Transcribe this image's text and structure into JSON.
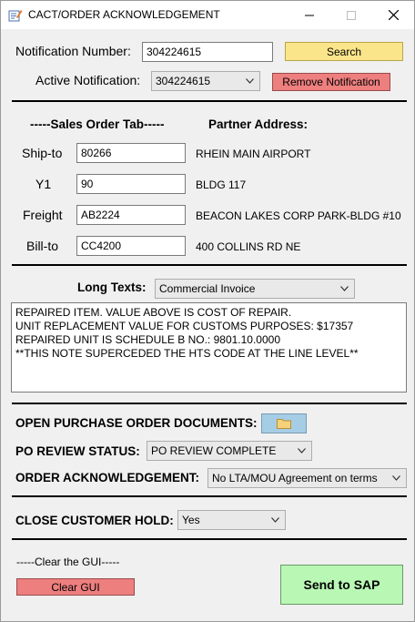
{
  "window": {
    "title": "CACT/ORDER ACKNOWLEDGEMENT"
  },
  "notification": {
    "number_label": "Notification Number:",
    "number_value": "304224615",
    "search_label": "Search",
    "active_label": "Active Notification:",
    "active_value": "304224615",
    "remove_label": "Remove Notification"
  },
  "sales_order": {
    "header": "-----Sales Order Tab-----",
    "partner_header": "Partner Address:",
    "rows": [
      {
        "label": "Ship-to",
        "value": "80266",
        "address": "RHEIN MAIN AIRPORT"
      },
      {
        "label": "Y1",
        "value": "90",
        "address": "BLDG 117"
      },
      {
        "label": "Freight",
        "value": "AB2224",
        "address": "BEACON LAKES CORP PARK-BLDG #10"
      },
      {
        "label": "Bill-to",
        "value": "CC4200",
        "address": "400 COLLINS RD NE"
      }
    ]
  },
  "long_texts": {
    "label": "Long Texts:",
    "selected": "Commercial Invoice",
    "lines": [
      "REPAIRED ITEM.  VALUE ABOVE IS COST OF REPAIR.",
      "UNIT REPLACEMENT VALUE FOR CUSTOMS PURPOSES: $17357",
      "REPAIRED UNIT IS SCHEDULE B NO.: 9801.10.0000",
      "**THIS NOTE SUPERCEDED THE HTS CODE AT THE LINE LEVEL**"
    ]
  },
  "po": {
    "open_docs_label": "OPEN PURCHASE ORDER DOCUMENTS:",
    "review_label": "PO REVIEW STATUS:",
    "review_value": "PO REVIEW COMPLETE",
    "ack_label": "ORDER ACKNOWLEDGEMENT:",
    "ack_value": "No LTA/MOU Agreement on terms"
  },
  "hold": {
    "label": "CLOSE CUSTOMER HOLD:",
    "value": "Yes"
  },
  "footer": {
    "clear_caption": "-----Clear the GUI-----",
    "clear_label": "Clear GUI",
    "send_label": "Send to SAP"
  },
  "colors": {
    "search_button": "#fbe58b",
    "remove_button": "#ee7f7f",
    "folder_button": "#a6cde6",
    "send_button": "#b9f7b4"
  }
}
